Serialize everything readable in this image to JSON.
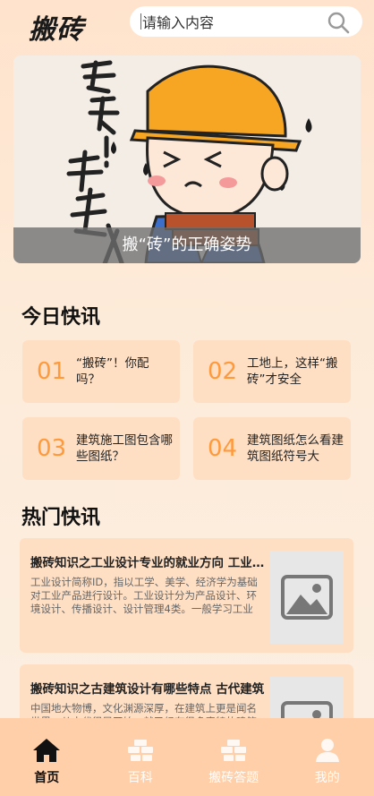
{
  "header": {
    "logo": "搬砖",
    "search_placeholder": "请输入内容"
  },
  "banner": {
    "caption": "搬“砖”的正确姿势",
    "art_text": "砖吧!打工人"
  },
  "today": {
    "title": "今日快讯",
    "items": [
      {
        "num": "01",
        "text": "“搬砖”！你配吗？"
      },
      {
        "num": "02",
        "text": "工地上，这样“搬砖”才安全"
      },
      {
        "num": "03",
        "text": "建筑施工图包含哪些图纸？"
      },
      {
        "num": "04",
        "text": "建筑图纸怎么看建筑图纸符号大"
      }
    ]
  },
  "hot": {
    "title": "热门快讯",
    "items": [
      {
        "title": "搬砖知识之工业设计专业的就业方向 工业设计",
        "desc": "工业设计简称ID，指以工学、美学、经济学为基础对工业产品进行设计。工业设计分为产品设计、环境设计、传播设计、设计管理4类。一般学习工业"
      },
      {
        "title": "搬砖知识之古建筑设计有哪些特点 古代建筑",
        "desc": "中国地大物博，文化渊源深厚，在建筑上更是闻名世界，从古代很早开始，就已经有很多奇特的建筑"
      }
    ]
  },
  "tabs": [
    {
      "label": "首页",
      "active": true
    },
    {
      "label": "百科",
      "active": false
    },
    {
      "label": "搬砖答题",
      "active": false
    },
    {
      "label": "我的",
      "active": false
    }
  ],
  "colors": {
    "accent": "#ff9a3c",
    "card": "#ffdfc4",
    "tabbar": "#ffcfa9"
  }
}
